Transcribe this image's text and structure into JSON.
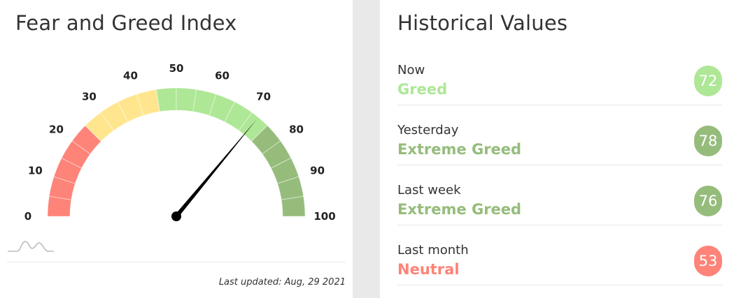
{
  "fear_greed": {
    "title": "Fear and Greed Index",
    "value": 72,
    "scale_labels": [
      "0",
      "10",
      "20",
      "30",
      "40",
      "50",
      "60",
      "70",
      "80",
      "90",
      "100"
    ],
    "zone_colors": {
      "extreme_fear": "#fe8378",
      "fear": "#ffe68e",
      "neutral": "#aee796",
      "greed": "#aee796",
      "extreme_greed": "#96bc7c"
    },
    "last_updated": "Last updated: Aug, 29 2021"
  },
  "historical": {
    "title": "Historical Values",
    "rows": [
      {
        "period": "Now",
        "status": "Greed",
        "value": "72",
        "color": "#aee796"
      },
      {
        "period": "Yesterday",
        "status": "Extreme Greed",
        "value": "78",
        "color": "#96bc7c"
      },
      {
        "period": "Last week",
        "status": "Extreme Greed",
        "value": "76",
        "color": "#96bc7c"
      },
      {
        "period": "Last month",
        "status": "Neutral",
        "value": "53",
        "color": "#fe8378"
      }
    ]
  }
}
